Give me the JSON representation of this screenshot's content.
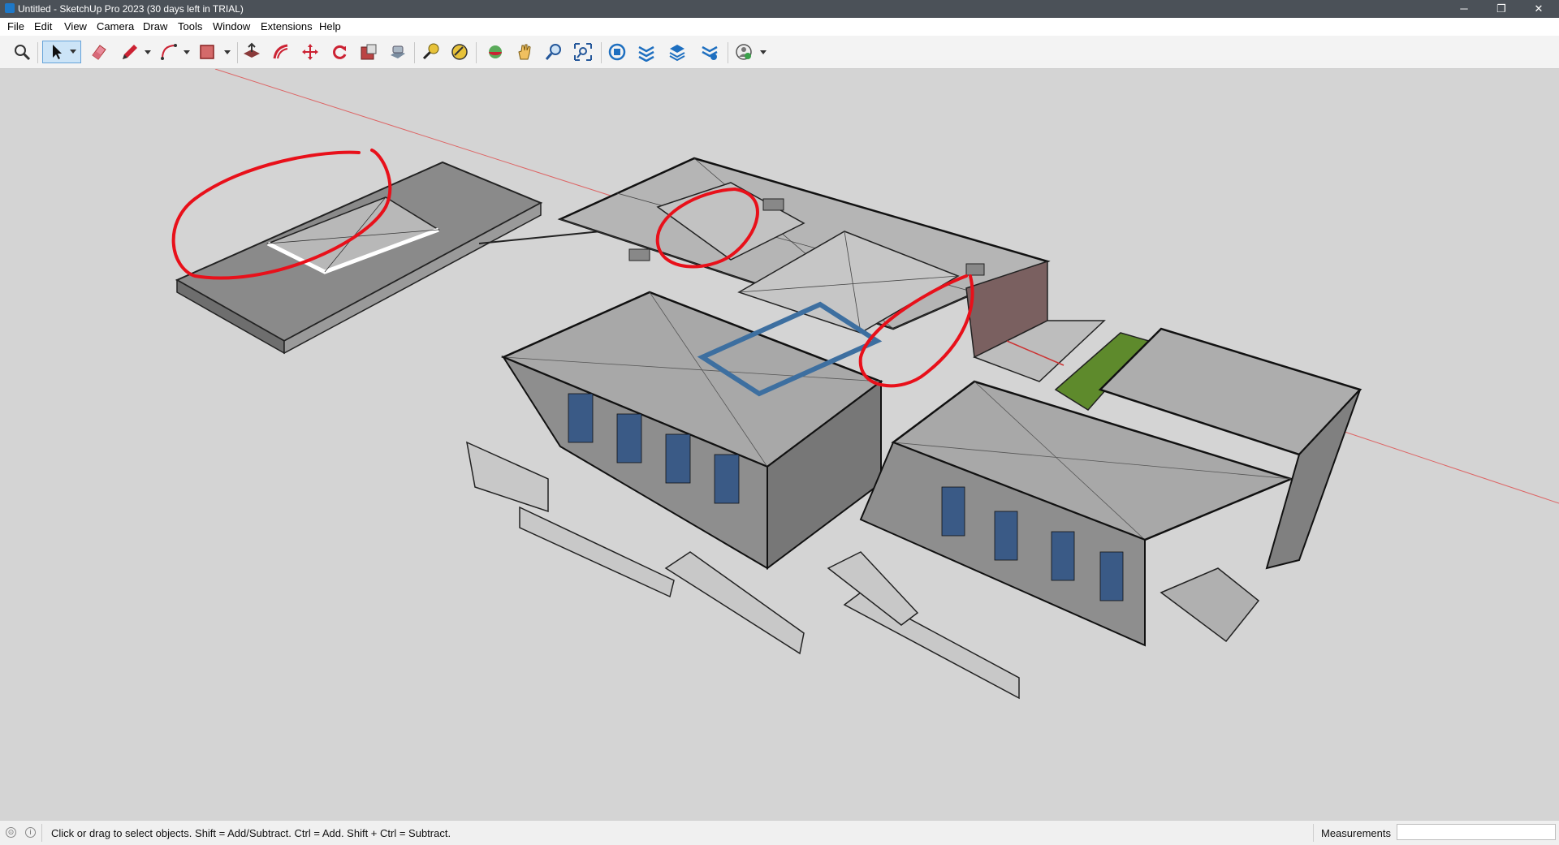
{
  "window": {
    "title": "Untitled - SketchUp Pro 2023 (30 days left in TRIAL)",
    "controls": {
      "minimize": "─",
      "restore": "❐",
      "close": "✕"
    }
  },
  "menu": [
    "File",
    "Edit",
    "View",
    "Camera",
    "Draw",
    "Tools",
    "Window",
    "Extensions",
    "Help"
  ],
  "toolbar": {
    "tools": [
      {
        "icon": "zoom-magnifier-icon"
      },
      {
        "icon": "select-arrow-icon",
        "active": true,
        "dropdown": true
      },
      {
        "icon": "eraser-icon"
      },
      {
        "icon": "pencil-line-icon",
        "dropdown": true
      },
      {
        "icon": "arc-icon",
        "dropdown": true
      },
      {
        "icon": "rectangle-shape-icon",
        "dropdown": true
      },
      {
        "icon": "push-pull-icon"
      },
      {
        "icon": "offset-icon"
      },
      {
        "icon": "move-icon"
      },
      {
        "icon": "rotate-icon"
      },
      {
        "icon": "scale-icon"
      },
      {
        "icon": "follow-me-icon"
      },
      {
        "icon": "tape-measure-icon"
      },
      {
        "icon": "paint-bucket-icon"
      },
      {
        "icon": "orbit-icon"
      },
      {
        "icon": "pan-hand-icon"
      },
      {
        "icon": "zoom-icon"
      },
      {
        "icon": "zoom-extents-icon"
      },
      {
        "icon": "3d-warehouse-icon"
      },
      {
        "icon": "extension-warehouse-icon"
      },
      {
        "icon": "layout-icon"
      },
      {
        "icon": "extension-manager-icon"
      },
      {
        "icon": "trimble-connect-icon",
        "dropdown": true
      }
    ]
  },
  "status": {
    "hint": "Click or drag to select objects. Shift = Add/Subtract. Ctrl = Add. Shift + Ctrl = Subtract.",
    "measurements_label": "Measurements",
    "measurements_value": ""
  },
  "colors": {
    "titlebar": "#4b5158",
    "viewport_bg": "#d4d4d4",
    "annotation_red": "#e8101a",
    "axis_red": "#d44",
    "roof": "#a8a8a8",
    "wall": "#8f8f8f",
    "glass": "#3a5a86",
    "lawn": "#5e8a2c"
  }
}
